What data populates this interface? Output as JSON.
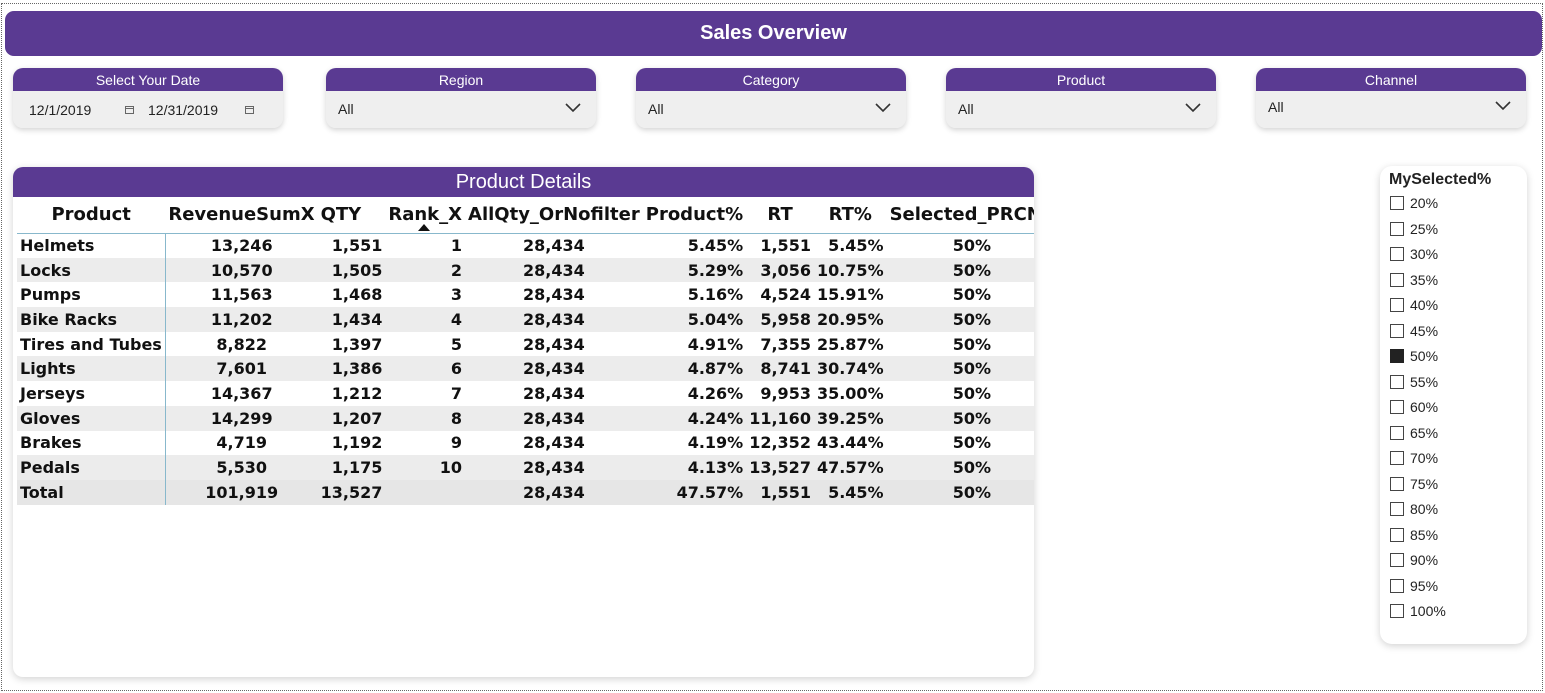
{
  "header": {
    "title": "Sales Overview"
  },
  "filters": {
    "date": {
      "label": "Select Your Date",
      "start": "12/1/2019",
      "end": "12/31/2019"
    },
    "region": {
      "label": "Region",
      "value": "All"
    },
    "category": {
      "label": "Category",
      "value": "All"
    },
    "product": {
      "label": "Product",
      "value": "All"
    },
    "channel": {
      "label": "Channel",
      "value": "All"
    }
  },
  "table": {
    "title": "Product Details",
    "columns": [
      "Product",
      "RevenueSumX",
      "QTY",
      "Rank_X",
      "AllQty_OrNofilter",
      "Product%",
      "RT",
      "RT%",
      "Selected_PRCNT"
    ],
    "sorted_column": "Rank_X",
    "rows": [
      [
        "Helmets",
        "13,246",
        "1,551",
        "1",
        "28,434",
        "5.45%",
        "1,551",
        "5.45%",
        "50%"
      ],
      [
        "Locks",
        "10,570",
        "1,505",
        "2",
        "28,434",
        "5.29%",
        "3,056",
        "10.75%",
        "50%"
      ],
      [
        "Pumps",
        "11,563",
        "1,468",
        "3",
        "28,434",
        "5.16%",
        "4,524",
        "15.91%",
        "50%"
      ],
      [
        "Bike Racks",
        "11,202",
        "1,434",
        "4",
        "28,434",
        "5.04%",
        "5,958",
        "20.95%",
        "50%"
      ],
      [
        "Tires and Tubes",
        "8,822",
        "1,397",
        "5",
        "28,434",
        "4.91%",
        "7,355",
        "25.87%",
        "50%"
      ],
      [
        "Lights",
        "7,601",
        "1,386",
        "6",
        "28,434",
        "4.87%",
        "8,741",
        "30.74%",
        "50%"
      ],
      [
        "Jerseys",
        "14,367",
        "1,212",
        "7",
        "28,434",
        "4.26%",
        "9,953",
        "35.00%",
        "50%"
      ],
      [
        "Gloves",
        "14,299",
        "1,207",
        "8",
        "28,434",
        "4.24%",
        "11,160",
        "39.25%",
        "50%"
      ],
      [
        "Brakes",
        "4,719",
        "1,192",
        "9",
        "28,434",
        "4.19%",
        "12,352",
        "43.44%",
        "50%"
      ],
      [
        "Pedals",
        "5,530",
        "1,175",
        "10",
        "28,434",
        "4.13%",
        "13,527",
        "47.57%",
        "50%"
      ]
    ],
    "total": [
      "Total",
      "101,919",
      "13,527",
      "",
      "28,434",
      "47.57%",
      "1,551",
      "5.45%",
      "50%"
    ]
  },
  "selector": {
    "title": "MySelected%",
    "options": [
      "20%",
      "25%",
      "30%",
      "35%",
      "40%",
      "45%",
      "50%",
      "55%",
      "60%",
      "65%",
      "70%",
      "75%",
      "80%",
      "85%",
      "90%",
      "95%",
      "100%"
    ],
    "selected": "50%"
  },
  "colors": {
    "accent": "#5a3a92",
    "row_alt": "#ececec",
    "divider": "#88b8cc"
  },
  "icons": {
    "dropdown": "chevron-down-icon",
    "date": "calendar-icon",
    "sort": "sort-ascending-icon"
  }
}
